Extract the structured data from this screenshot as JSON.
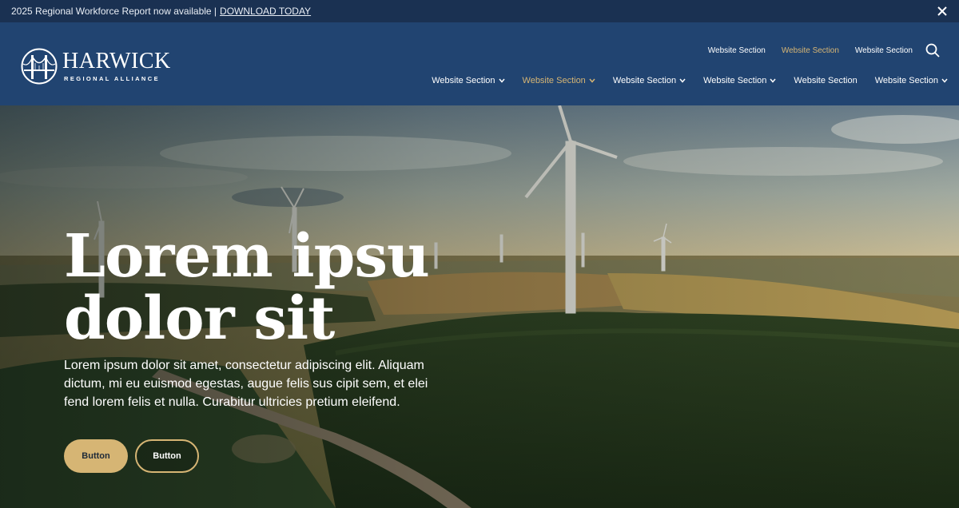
{
  "announcement": {
    "text": "2025 Regional Workforce Report now available |",
    "link_label": "DOWNLOAD TODAY",
    "close_icon": "close-icon"
  },
  "brand": {
    "name": "HARWICK",
    "tagline": "REGIONAL ALLIANCE",
    "logo_icon": "bridge-emblem-icon"
  },
  "utility_nav": [
    {
      "label": "Website Section",
      "active": false
    },
    {
      "label": "Website Section",
      "active": true
    },
    {
      "label": "Website Section",
      "active": false
    }
  ],
  "search_icon": "search-icon",
  "main_nav": [
    {
      "label": "Website Section",
      "has_dropdown": true,
      "active": false
    },
    {
      "label": "Website Section",
      "has_dropdown": true,
      "active": true
    },
    {
      "label": "Website Section",
      "has_dropdown": true,
      "active": false
    },
    {
      "label": "Website Section",
      "has_dropdown": true,
      "active": false
    },
    {
      "label": "Website Section",
      "has_dropdown": false,
      "active": false
    },
    {
      "label": "Website Section",
      "has_dropdown": true,
      "active": false
    }
  ],
  "hero": {
    "headline_line1": "Lorem ipsu",
    "headline_line2": "dolor sit",
    "body": "Lorem ipsum dolor sit amet, consectetur adipiscing elit. Aliquam dictum, mi eu euismod egestas, augue felis sus cipit sem, et elei fend lorem felis et nulla. Curabitur ultricies pretium eleifend.",
    "primary_button": "Button",
    "secondary_button": "Button",
    "image_subject": "wind-turbines-over-forest-landscape"
  },
  "colors": {
    "header_bg": "#214471",
    "announcement_bg": "#1a3152",
    "accent_gold": "#d6b574",
    "text_light": "#ffffff"
  }
}
